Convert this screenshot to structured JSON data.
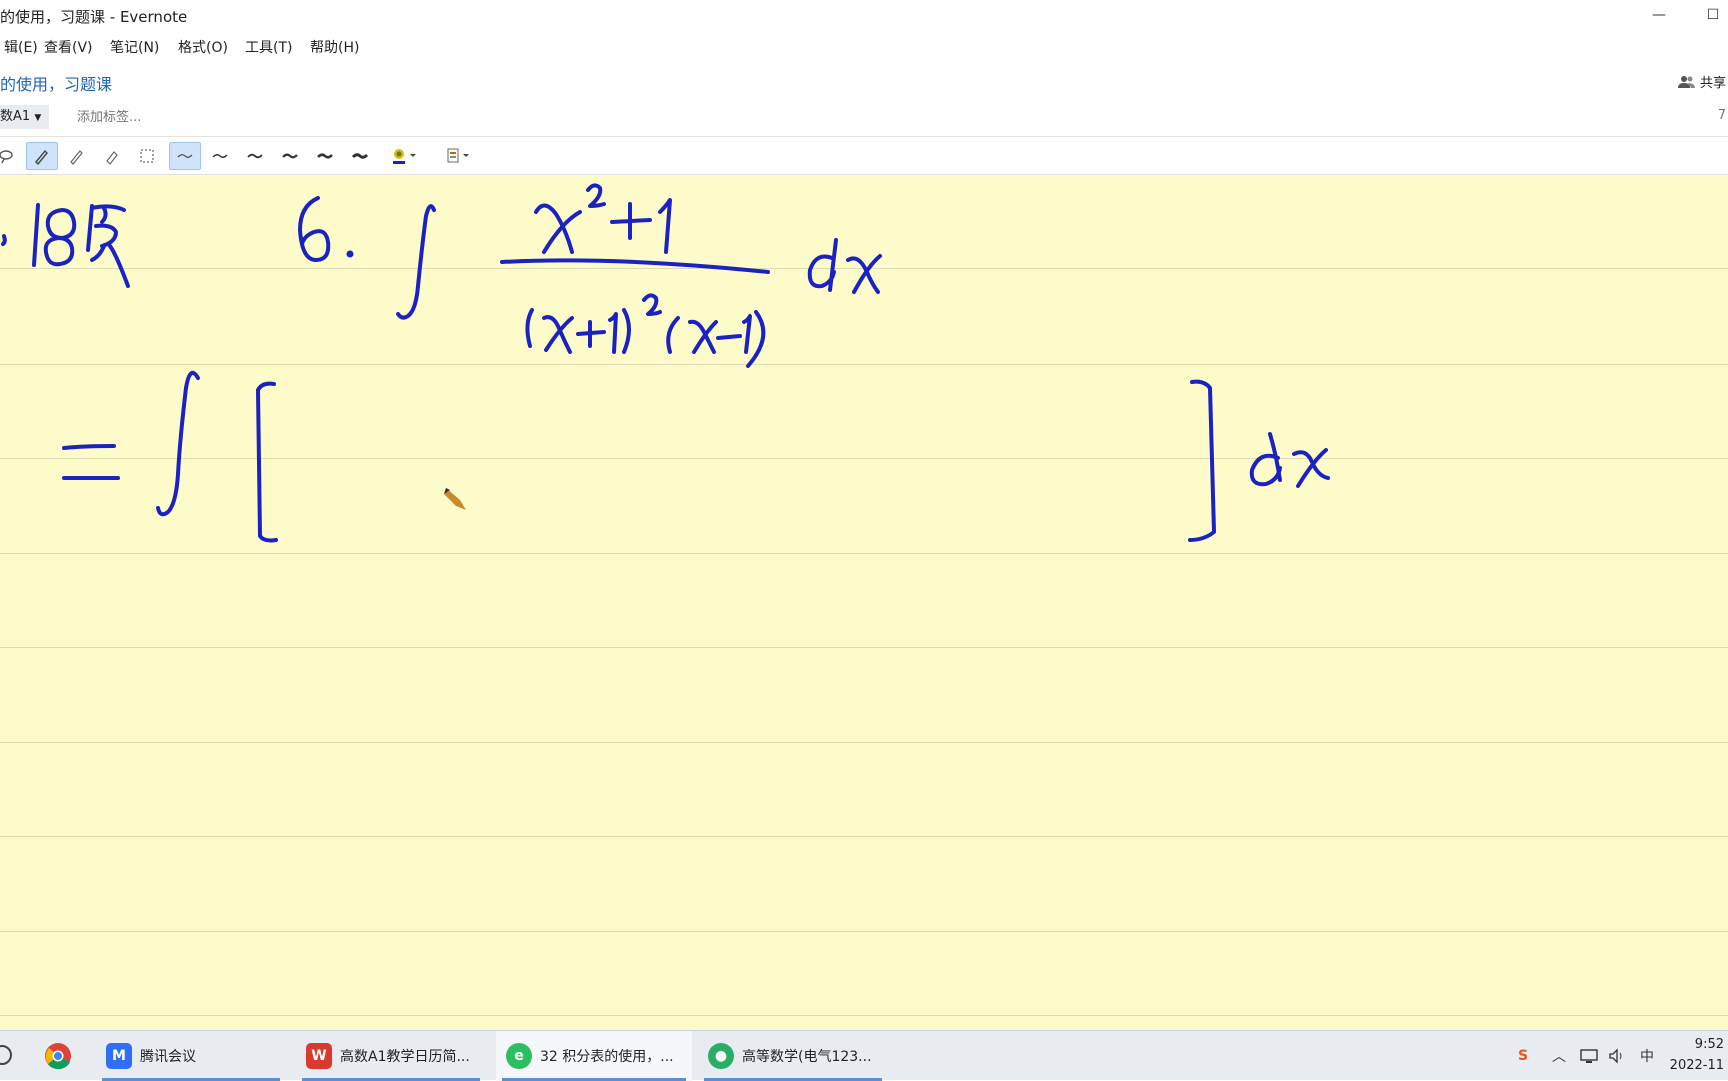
{
  "window": {
    "title": "的使用，习题课 - Evernote",
    "minimize_glyph": "—",
    "restore_glyph": "☐"
  },
  "menu": {
    "items": [
      "辑(E)",
      "查看(V)",
      "笔记(N)",
      "格式(O)",
      "工具(T)",
      "帮助(H)"
    ]
  },
  "note": {
    "title": "的使用，习题课",
    "share_label": "共享",
    "notebook": "数A1",
    "tag_placeholder": "添加标签...",
    "count_text": "7"
  },
  "ink_toolbar": {
    "tools": [
      "lasso-icon",
      "pen-icon",
      "pencil-icon",
      "highlighter-icon",
      "selection-icon",
      "stroke-width-1-icon",
      "stroke-width-2-icon",
      "stroke-width-3-icon",
      "stroke-width-4-icon",
      "stroke-width-5-icon",
      "stroke-width-6-icon",
      "color-picker-icon",
      "page-style-icon"
    ],
    "active_tool": "pen-icon",
    "active_width": "stroke-width-1-icon",
    "ink_color": "#1a23c2"
  },
  "canvas": {
    "background": "#fdfbc9",
    "rule_color": "#dedcb4",
    "handwriting": {
      "line1_left": "18页",
      "line1_problem": "6.",
      "numerator": "x²+1",
      "denominator": "(x+1)²(x−1)",
      "differential": "dx",
      "line2": "= ∫ [ ] dx"
    }
  },
  "taskbar": {
    "items": [
      {
        "label": "腾讯会议",
        "icon": "tencent-meeting-icon",
        "color": "#2f6ef5"
      },
      {
        "label": "高数A1教学日历简...",
        "icon": "wps-icon",
        "color": "#d93a2b"
      },
      {
        "label": "32 积分表的使用，...",
        "icon": "evernote-icon",
        "color": "#2dbe60"
      },
      {
        "label": "高等数学(电气123...",
        "icon": "wechat-icon",
        "color": "#2aae67"
      }
    ],
    "clock_time": "9:52",
    "clock_date": "2022-11",
    "ime_label": "中",
    "sogou_label": "S"
  }
}
